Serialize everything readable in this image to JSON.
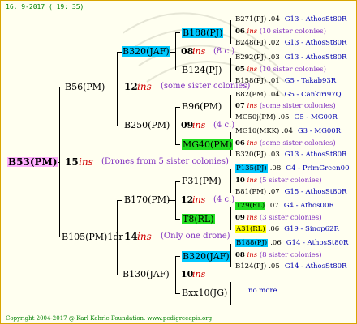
{
  "header": {
    "date": "16.  9-2017 ( 19: 35)"
  },
  "footer": {
    "copyright": "Copyright 2004-2017 @ Karl Kehrle Foundation.   www.pedigreeapis.org"
  },
  "root": {
    "label": "B53(PM)",
    "year": "15",
    "ins": "ins",
    "note": "(Drones from 5 sister colonies)"
  },
  "gen1": {
    "b56": {
      "label": "B56(PM)",
      "year": "12",
      "ins": "ins",
      "note": "(some sister colonies)"
    },
    "b105": {
      "label": "B105(PM)1dr",
      "year": "14",
      "ins": "ins",
      "note": "(Only one drone)"
    }
  },
  "gen2": {
    "b320a": {
      "label": "B320(JAF)"
    },
    "b250": {
      "label": "B250(PM)"
    },
    "b170": {
      "label": "B170(PM)"
    },
    "b130": {
      "label": "B130(JAF)"
    }
  },
  "gen3": {
    "b188a": {
      "label": "B188(PJ)",
      "year": "08",
      "ins": "ins",
      "note": "(8 c.)"
    },
    "b124": {
      "label": "B124(PJ)"
    },
    "b96": {
      "label": "B96(PM)",
      "year": "09",
      "ins": "ins",
      "note": "(4 c.)"
    },
    "mg40": {
      "label": "MG40(PM)"
    },
    "p31": {
      "label": "P31(PM)",
      "year": "12",
      "ins": "ins",
      "note": "(4 c.)"
    },
    "t8": {
      "label": "T8(RL)"
    },
    "b320b": {
      "label": "B320(JAF)",
      "year": "10",
      "ins": "ins"
    },
    "bxx10": {
      "label": "Bxx10(JG)"
    }
  },
  "gen4": [
    {
      "label": "B271(PJ)",
      "num": ".04",
      "extra": "G13 - AthosSt80R"
    },
    {
      "label": "06",
      "ins": "ins",
      "extra": "(10 sister colonies)"
    },
    {
      "label": "B248(PJ)",
      "num": ".02",
      "extra": "G13 - AthosSt80R"
    },
    {
      "label": "B292(PJ)",
      "num": ".03",
      "extra": "G13 - AthosSt80R"
    },
    {
      "label": "05",
      "ins": "ins",
      "extra": "(10 sister colonies)"
    },
    {
      "label": "B158(PJ)",
      "num": ".01",
      "extra": "G5 - Takab93R"
    },
    {
      "label": "B82(PM)",
      "num": ".04",
      "extra": "G5 - Cankiri97Q"
    },
    {
      "label": "07",
      "ins": "ins",
      "extra": "(some sister colonies)"
    },
    {
      "label": "MG50j(PM)",
      "num": ".05",
      "extra": "G5 - MG00R"
    },
    {
      "label": "MG10(MKK)",
      "num": ".04",
      "extra": "G3 - MG00R"
    },
    {
      "label": "06",
      "ins": "ins",
      "extra": "(some sister colonies)"
    },
    {
      "label": "B320(PJ)",
      "num": ".03",
      "extra": "G13 - AthosSt80R"
    },
    {
      "label": "P135(PJ)",
      "num": ".08",
      "extra": "G4 - PrimGreen00"
    },
    {
      "label": "10",
      "ins": "ins",
      "extra": "(5 sister colonies)"
    },
    {
      "label": "B81(PM)",
      "num": ".07",
      "extra": "G15 - AthosSt80R"
    },
    {
      "label": "T29(RL)",
      "num": ".07",
      "extra": "G4 - Athos00R"
    },
    {
      "label": "09",
      "ins": "ins",
      "extra": "(3 sister colonies)"
    },
    {
      "label": "A31(RL)",
      "num": ".06",
      "extra": "G19 - Sinop62R"
    },
    {
      "label": "B188(PJ)",
      "num": ".06",
      "extra": "G14 - AthosSt80R"
    },
    {
      "label": "08",
      "ins": "ins",
      "extra": "(8 sister colonies)"
    },
    {
      "label": "B124(PJ)",
      "num": ".05",
      "extra": "G14 - AthosSt80R"
    },
    {
      "label": "no more"
    }
  ]
}
